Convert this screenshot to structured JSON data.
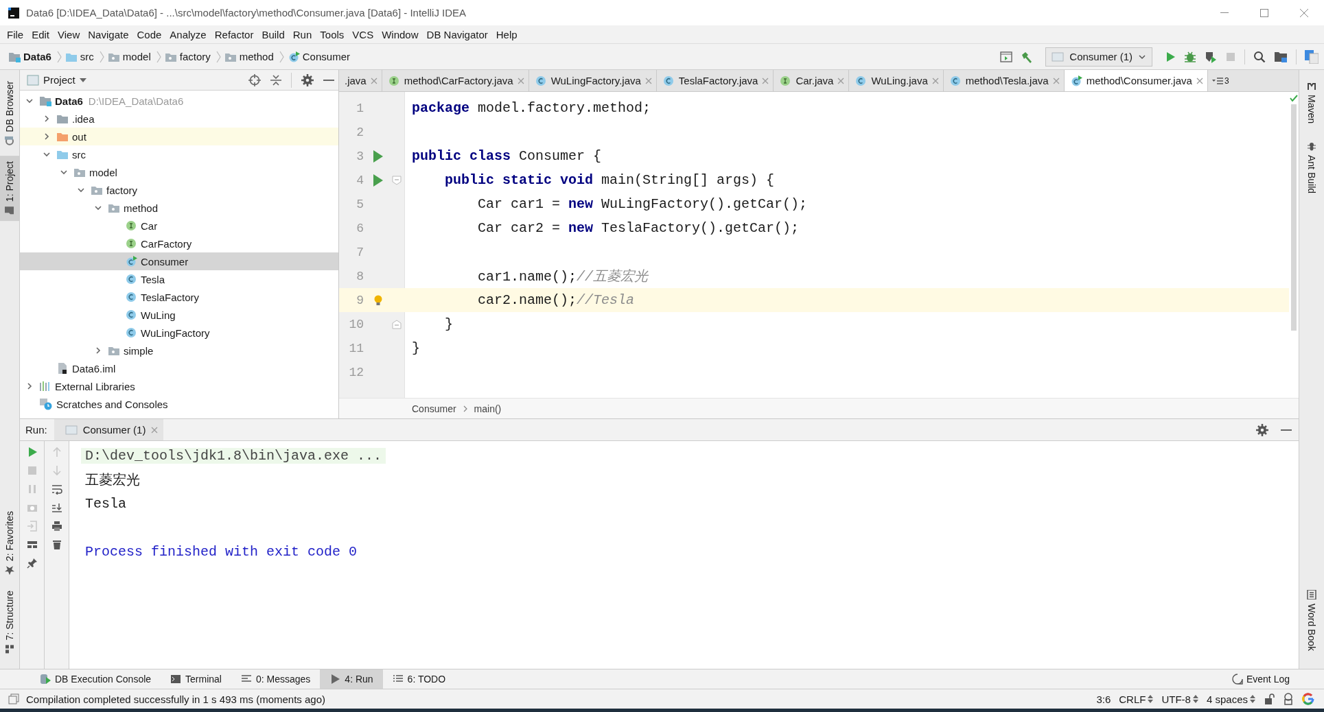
{
  "window": {
    "title": "Data6 [D:\\IDEA_Data\\Data6] - ...\\src\\model\\factory\\method\\Consumer.java [Data6] - IntelliJ IDEA"
  },
  "menu": [
    "File",
    "Edit",
    "View",
    "Navigate",
    "Code",
    "Analyze",
    "Refactor",
    "Build",
    "Run",
    "Tools",
    "VCS",
    "Window",
    "DB Navigator",
    "Help"
  ],
  "navigation": [
    {
      "label": "Data6",
      "kind": "module"
    },
    {
      "label": "src",
      "kind": "source-folder"
    },
    {
      "label": "model",
      "kind": "package"
    },
    {
      "label": "factory",
      "kind": "package"
    },
    {
      "label": "method",
      "kind": "package"
    },
    {
      "label": "Consumer",
      "kind": "class-run"
    }
  ],
  "run_config": {
    "label": "Consumer (1)"
  },
  "left_stripe": {
    "top": [
      {
        "label": "DB Browser",
        "selected": false
      },
      {
        "label": "1: Project",
        "selected": true
      }
    ],
    "bottom": [
      {
        "label": "2: Favorites",
        "selected": false
      },
      {
        "label": "7: Structure",
        "selected": false
      }
    ]
  },
  "right_stripe": {
    "top": [
      {
        "label": "Maven"
      },
      {
        "label": "Ant Build"
      }
    ],
    "bottom": [
      {
        "label": "Word Book"
      }
    ]
  },
  "project": {
    "title": "Project",
    "tree": [
      {
        "label": "Data6",
        "path": "D:\\IDEA_Data\\Data6",
        "kind": "module",
        "expanded": true,
        "selected": false,
        "highlighted": false,
        "children": [
          {
            "label": ".idea",
            "kind": "folder",
            "expanded": false,
            "selected": false,
            "highlighted": false
          },
          {
            "label": "out",
            "kind": "excluded-folder",
            "expanded": false,
            "selected": false,
            "highlighted": true
          },
          {
            "label": "src",
            "kind": "source-folder",
            "expanded": true,
            "selected": false,
            "highlighted": false,
            "children": [
              {
                "label": "model",
                "kind": "package",
                "expanded": true,
                "selected": false,
                "highlighted": false,
                "children": [
                  {
                    "label": "factory",
                    "kind": "package",
                    "expanded": true,
                    "selected": false,
                    "highlighted": false,
                    "children": [
                      {
                        "label": "method",
                        "kind": "package",
                        "expanded": true,
                        "selected": false,
                        "highlighted": false,
                        "children": [
                          {
                            "label": "Car",
                            "kind": "interface",
                            "selected": false,
                            "highlighted": false
                          },
                          {
                            "label": "CarFactory",
                            "kind": "interface",
                            "selected": false,
                            "highlighted": false
                          },
                          {
                            "label": "Consumer",
                            "kind": "class-run",
                            "selected": true,
                            "highlighted": false
                          },
                          {
                            "label": "Tesla",
                            "kind": "class",
                            "selected": false,
                            "highlighted": false
                          },
                          {
                            "label": "TeslaFactory",
                            "kind": "class",
                            "selected": false,
                            "highlighted": false
                          },
                          {
                            "label": "WuLing",
                            "kind": "class",
                            "selected": false,
                            "highlighted": false
                          },
                          {
                            "label": "WuLingFactory",
                            "kind": "class",
                            "selected": false,
                            "highlighted": false
                          }
                        ]
                      },
                      {
                        "label": "simple",
                        "kind": "package",
                        "expanded": false,
                        "selected": false,
                        "highlighted": false
                      }
                    ]
                  }
                ]
              }
            ]
          },
          {
            "label": "Data6.iml",
            "kind": "iml",
            "selected": false,
            "highlighted": false
          }
        ]
      },
      {
        "label": "External Libraries",
        "kind": "libraries",
        "expanded": false,
        "selected": false,
        "highlighted": false
      },
      {
        "label": "Scratches and Consoles",
        "kind": "scratches",
        "selected": false,
        "highlighted": false
      }
    ]
  },
  "editor": {
    "tabs": [
      {
        "label": ".java",
        "kind": "none",
        "selected": false
      },
      {
        "label": "method\\CarFactory.java",
        "kind": "interface",
        "selected": false
      },
      {
        "label": "WuLingFactory.java",
        "kind": "class",
        "selected": false
      },
      {
        "label": "TeslaFactory.java",
        "kind": "class",
        "selected": false
      },
      {
        "label": "Car.java",
        "kind": "interface",
        "selected": false
      },
      {
        "label": "WuLing.java",
        "kind": "class",
        "selected": false
      },
      {
        "label": "method\\Tesla.java",
        "kind": "class",
        "selected": false
      },
      {
        "label": "method\\Consumer.java",
        "kind": "class-run",
        "selected": true
      }
    ],
    "hidden_tabs": "3",
    "lines": [
      {
        "number": "1",
        "run": false,
        "current": false,
        "tokens": [
          {
            "kind": "keyword",
            "text": "package"
          },
          {
            "kind": "plain",
            "text": " model.factory.method;"
          }
        ]
      },
      {
        "number": "2",
        "run": false,
        "current": false
      },
      {
        "number": "3",
        "run": true,
        "current": false,
        "tokens": [
          {
            "kind": "keyword",
            "text": "public class"
          },
          {
            "kind": "plain",
            "text": " Consumer {"
          }
        ]
      },
      {
        "number": "4",
        "run": true,
        "current": false,
        "fold_start": true,
        "tokens": [
          {
            "kind": "keyword",
            "text": "    public static void"
          },
          {
            "kind": "plain",
            "text": " main(String[] args) {"
          }
        ]
      },
      {
        "number": "5",
        "run": false,
        "current": false,
        "tokens": [
          {
            "kind": "plain",
            "text": "        Car car1 = "
          },
          {
            "kind": "keyword",
            "text": "new"
          },
          {
            "kind": "plain",
            "text": " WuLingFactory().getCar();"
          }
        ]
      },
      {
        "number": "6",
        "run": false,
        "current": false,
        "tokens": [
          {
            "kind": "plain",
            "text": "        Car car2 = "
          },
          {
            "kind": "keyword",
            "text": "new"
          },
          {
            "kind": "plain",
            "text": " TeslaFactory().getCar();"
          }
        ]
      },
      {
        "number": "7",
        "run": false,
        "current": false
      },
      {
        "number": "8",
        "run": false,
        "current": false,
        "tokens": [
          {
            "kind": "plain",
            "text": "        car1.name();"
          },
          {
            "kind": "comment",
            "text": "//五菱宏光"
          }
        ]
      },
      {
        "number": "9",
        "run": false,
        "current": true,
        "bulb": true,
        "tokens": [
          {
            "kind": "plain",
            "text": "        car2.name();"
          },
          {
            "kind": "comment",
            "text": "//Tesla"
          }
        ]
      },
      {
        "number": "10",
        "run": false,
        "current": false,
        "fold_end": true,
        "tokens": [
          {
            "kind": "plain",
            "text": "    }"
          }
        ]
      },
      {
        "number": "11",
        "run": false,
        "current": false,
        "tokens": [
          {
            "kind": "plain",
            "text": "}"
          }
        ]
      },
      {
        "number": "12",
        "run": false,
        "current": false
      }
    ],
    "breadcrumbs": [
      "Consumer",
      "main()"
    ]
  },
  "run": {
    "label": "Run:",
    "tab": "Consumer (1)",
    "console": [
      {
        "kind": "command",
        "text": "D:\\dev_tools\\jdk1.8\\bin\\java.exe ..."
      },
      {
        "kind": "output",
        "text": "五菱宏光"
      },
      {
        "kind": "output",
        "text": "Tesla"
      },
      {
        "kind": "exit",
        "text": "Process finished with exit code 0"
      }
    ]
  },
  "tool_windows": [
    {
      "label": "DB Execution Console",
      "kind": "db",
      "selected": false
    },
    {
      "label": "Terminal",
      "kind": "terminal",
      "selected": false
    },
    {
      "label": "0: Messages",
      "kind": "messages",
      "selected": false
    },
    {
      "label": "4: Run",
      "kind": "run",
      "selected": true
    },
    {
      "label": "6: TODO",
      "kind": "todo",
      "selected": false
    }
  ],
  "event_log": "Event Log",
  "status_bar": {
    "message": "Compilation completed successfully in 1 s 493 ms (moments ago)",
    "items": [
      {
        "label": "3:6",
        "kind": "plain"
      },
      {
        "label": "CRLF",
        "kind": "dropdown"
      },
      {
        "label": "UTF-8",
        "kind": "dropdown"
      },
      {
        "label": "4 spaces",
        "kind": "dropdown"
      }
    ]
  }
}
